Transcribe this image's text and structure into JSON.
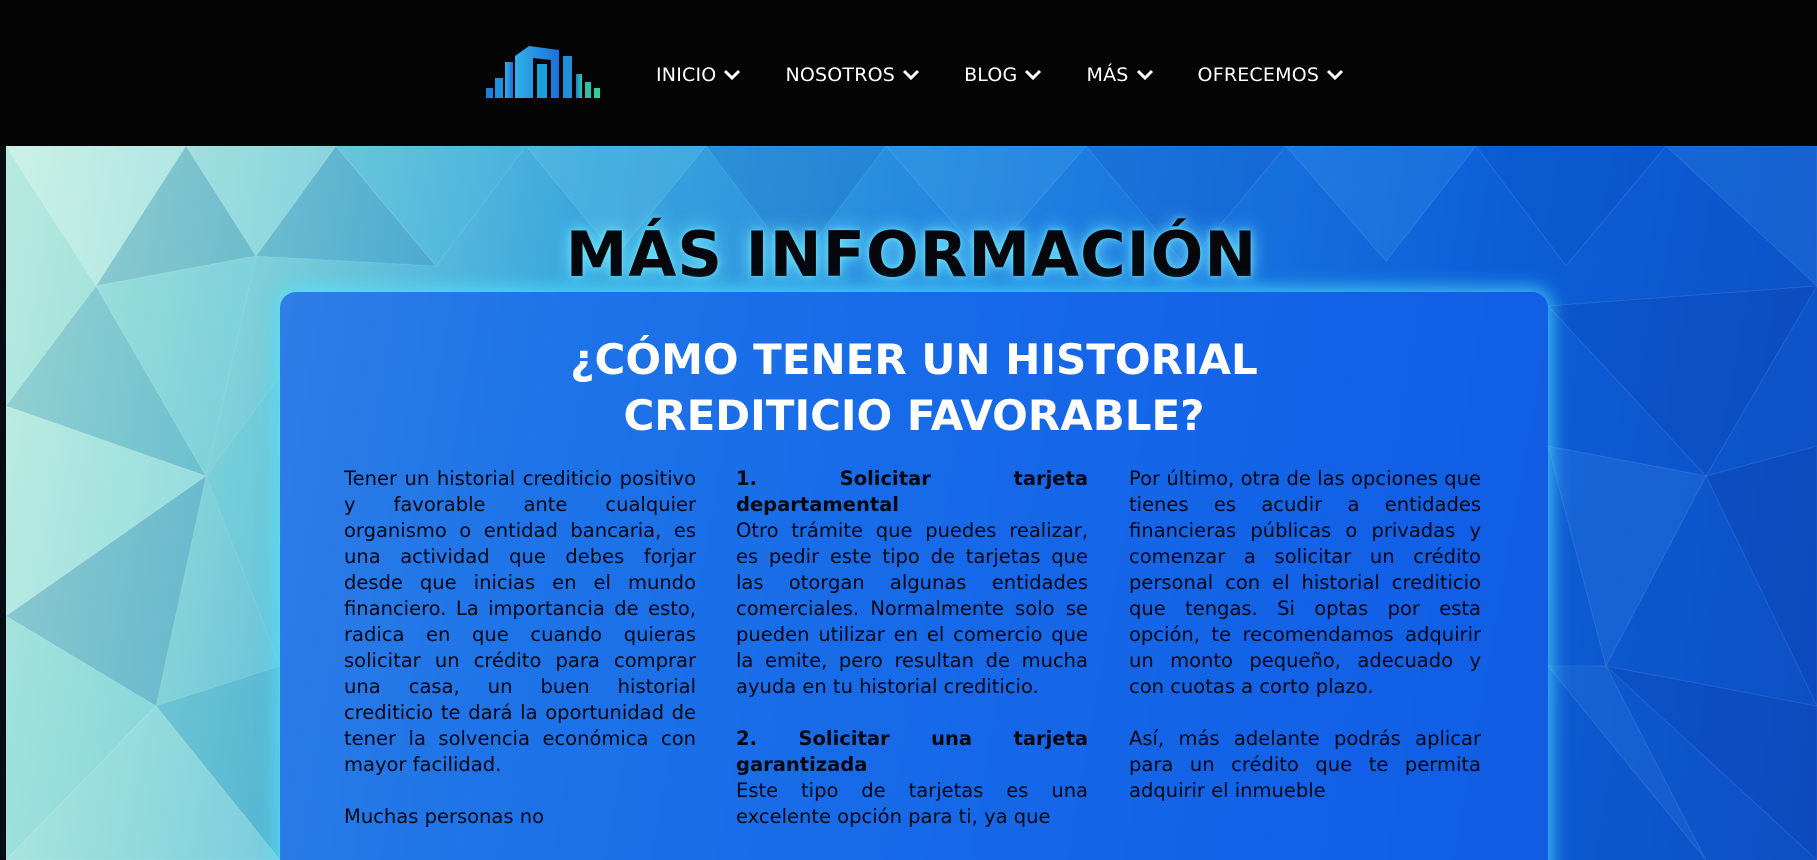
{
  "nav": {
    "logo_icon": "building-bars-logo",
    "items": [
      {
        "label": "INICIO",
        "icon": "chevron-down-icon"
      },
      {
        "label": "NOSOTROS",
        "icon": "chevron-down-icon"
      },
      {
        "label": "BLOG",
        "icon": "chevron-down-icon"
      },
      {
        "label": "MÁS",
        "icon": "chevron-down-icon"
      },
      {
        "label": "OFRECEMOS",
        "icon": "chevron-down-icon"
      }
    ]
  },
  "section": {
    "title": "MÁS INFORMACIÓN"
  },
  "article": {
    "title": "¿CÓMO TENER UN HISTORIAL CREDITICIO FAVORABLE?",
    "col1": {
      "p1": "Tener un historial crediticio positivo y favorable ante cualquier organismo o entidad bancaria, es una actividad que debes forjar desde que inicias en el mundo financiero. La importancia de esto, radica en que cuando quieras solicitar un crédito para comprar una casa, un buen historial crediticio te dará la oportunidad de tener la solvencia económica con mayor facilidad.",
      "p2": "Muchas personas no"
    },
    "col2": {
      "h1": "1. Solicitar tarjeta departamental",
      "p1": "Otro trámite que puedes realizar, es pedir este tipo de tarjetas que las otorgan algunas entidades comerciales. Normalmente solo se pueden utilizar en el comercio que la emite, pero resultan de mucha ayuda en tu historial crediticio.",
      "h2": "2. Solicitar una tarjeta garantizada",
      "p2": "Este tipo de tarjetas es una excelente opción para ti, ya que"
    },
    "col3": {
      "p1": "Por último, otra de las opciones que tienes es acudir a entidades financieras públicas o privadas y comenzar a solicitar un crédito personal con el historial crediticio que tengas. Si optas por esta opción, te recomendamos adquirir un monto pequeño, adecuado y con cuotas a corto plazo.",
      "p2": "Así, más adelante podrás aplicar para un crédito que te permita adquirir el inmueble"
    }
  },
  "colors": {
    "navbar_bg": "#040405",
    "card_bg": "#145feb",
    "card_glow": "#50e6ff",
    "logo_blue": "#1f7fd8",
    "logo_green": "#2fc4a0"
  }
}
